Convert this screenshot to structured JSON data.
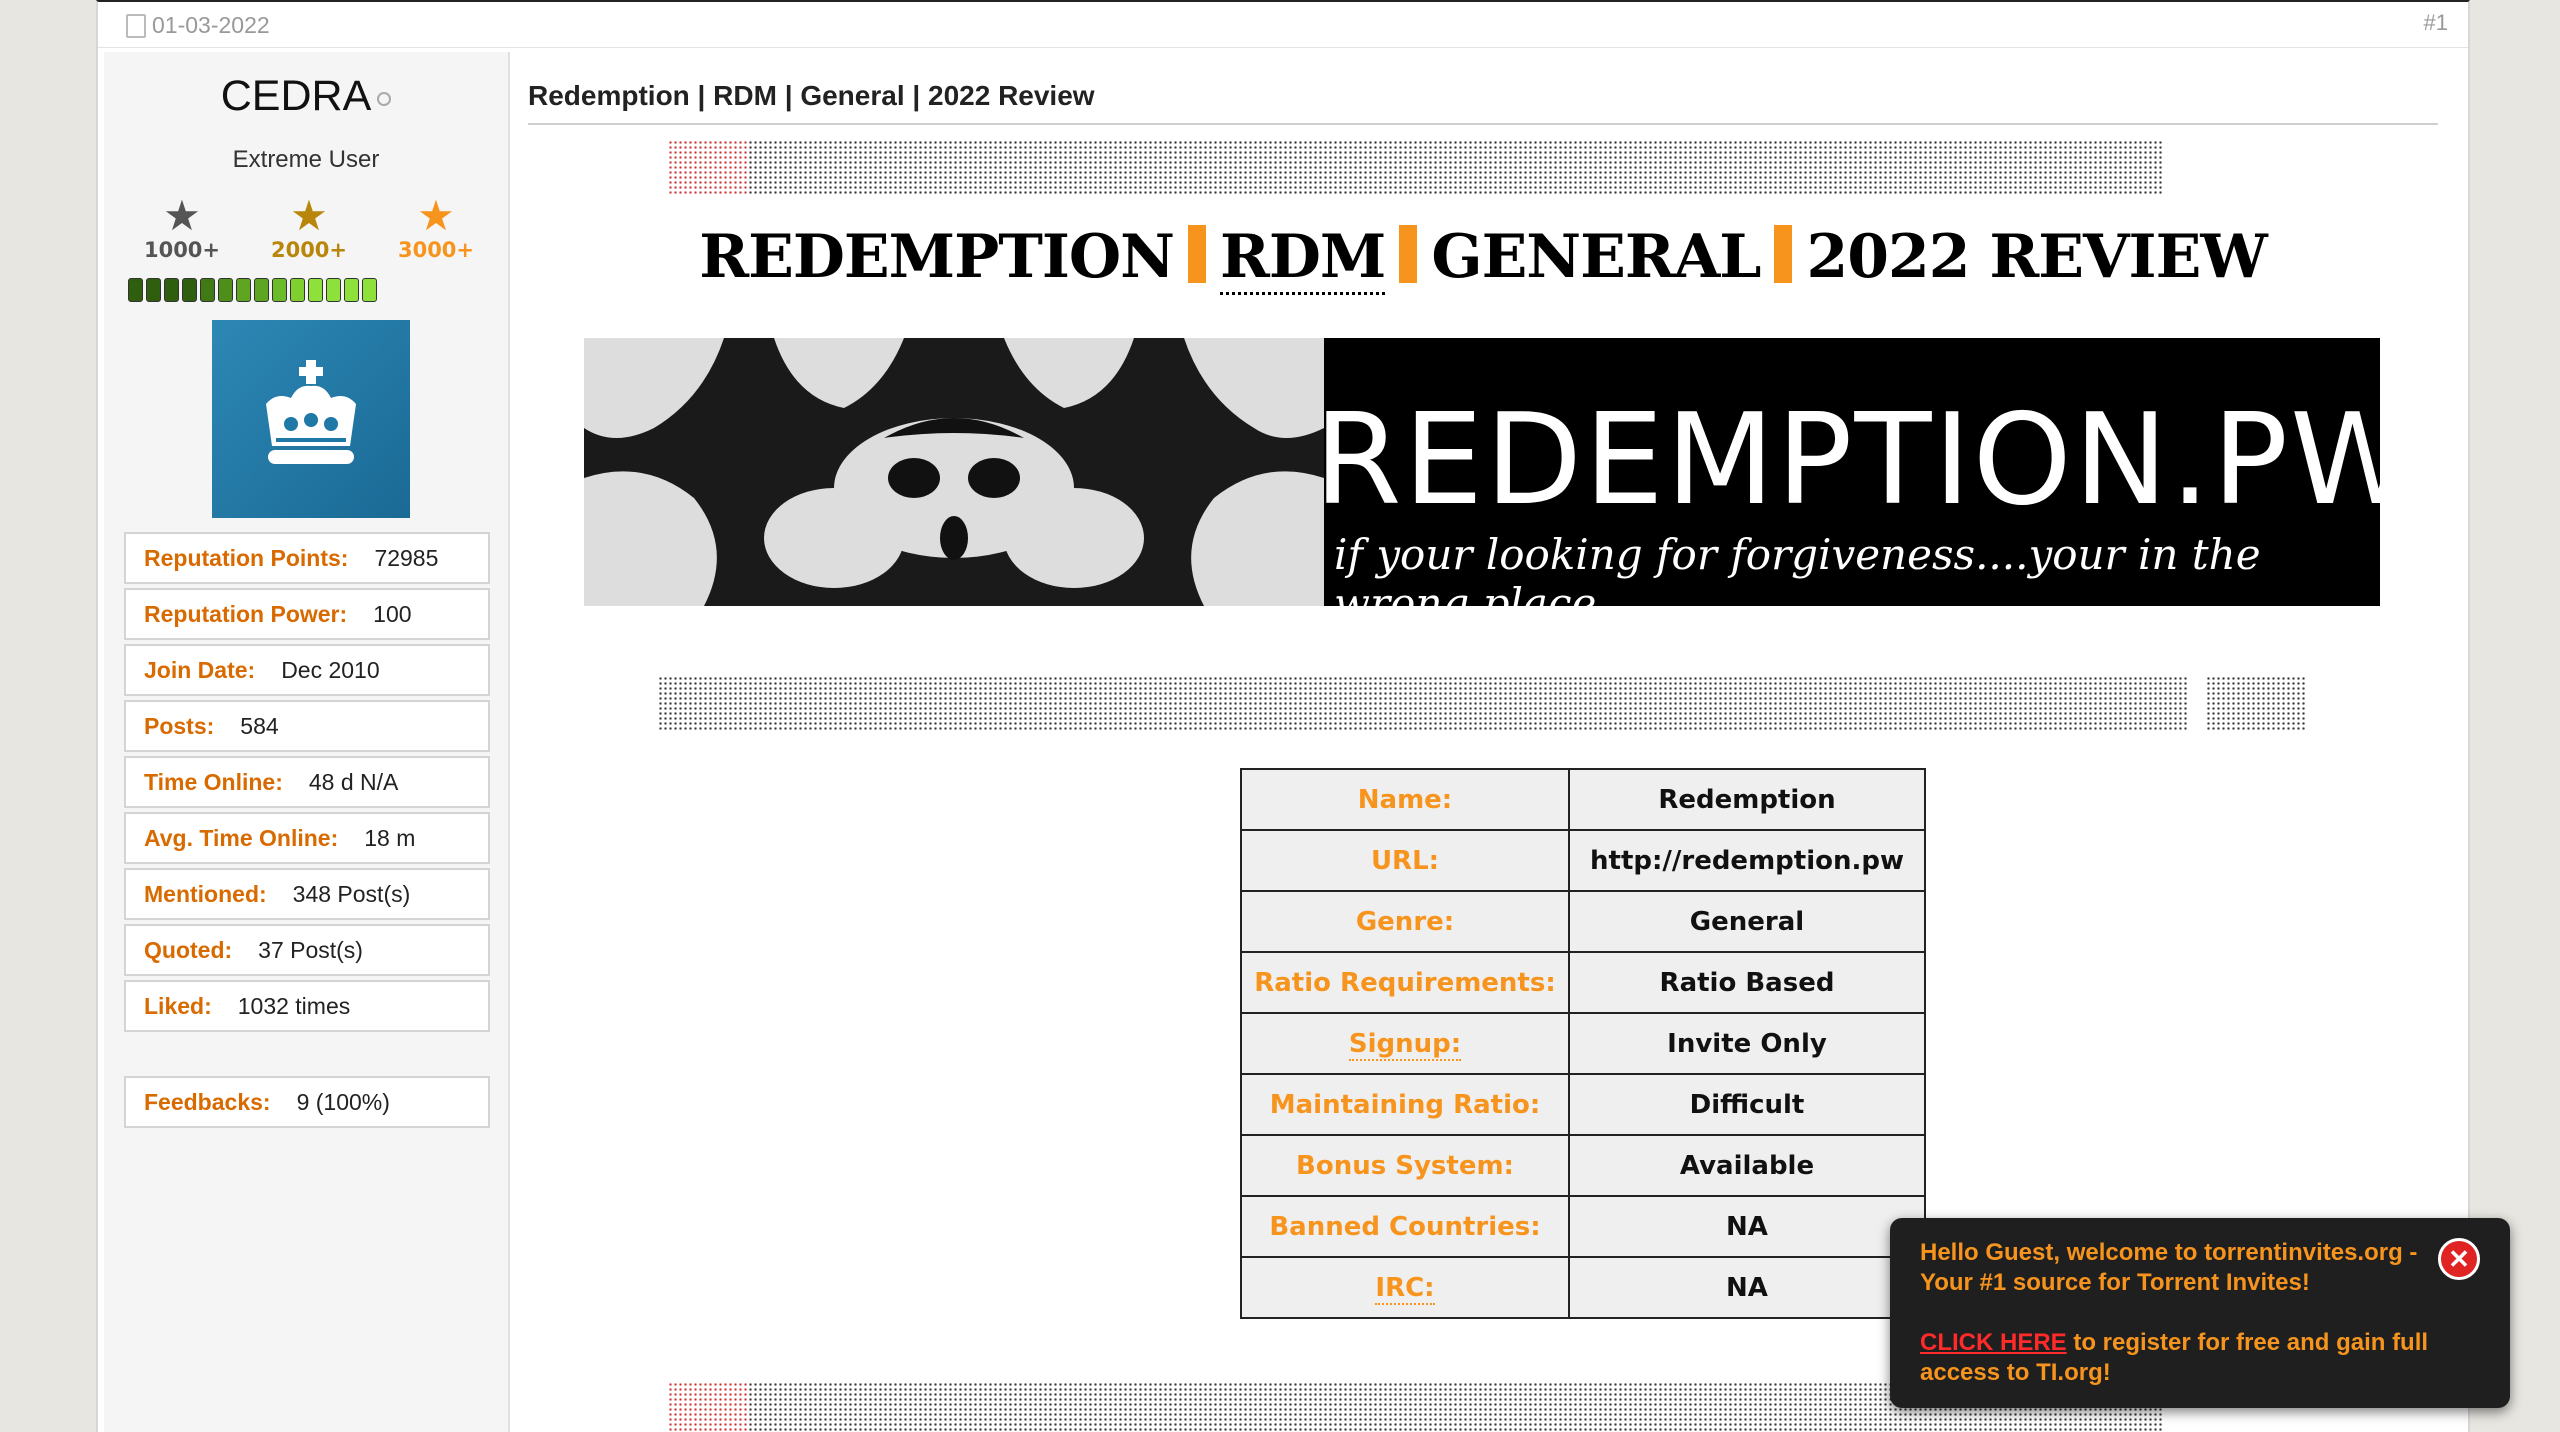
{
  "post": {
    "date": "01-03-2022",
    "number": "#1"
  },
  "user": {
    "name": "CEDRA",
    "title": "Extreme User",
    "awards": [
      {
        "label": "1000+",
        "color": "#555555"
      },
      {
        "label": "2000+",
        "color": "#b8860b"
      },
      {
        "label": "3000+",
        "color": "#f7941d"
      }
    ],
    "rep_segments": 14,
    "info": [
      {
        "label": "Reputation Points:",
        "value": "72985"
      },
      {
        "label": "Reputation Power:",
        "value": "100"
      },
      {
        "label": "Join Date:",
        "value": "Dec 2010"
      },
      {
        "label": "Posts:",
        "value": "584"
      },
      {
        "label": "Time Online:",
        "value": "48 d N/A"
      },
      {
        "label": "Avg. Time Online:",
        "value": "18 m"
      },
      {
        "label": "Mentioned:",
        "value": "348 Post(s)"
      },
      {
        "label": "Quoted:",
        "value": "37 Post(s)"
      },
      {
        "label": "Liked:",
        "value": "1032 times"
      }
    ],
    "feedback": {
      "label": "Feedbacks:",
      "value": "9 (100%)"
    }
  },
  "content": {
    "title": "Redemption | RDM | General | 2022 Review",
    "headline": [
      "REDEMPTION",
      "RDM",
      "GENERAL",
      "2022 REVIEW"
    ],
    "banner": {
      "title": "REDEMPTION.PW",
      "subtitle": "if your looking for forgiveness....your in the wrong place"
    },
    "table": [
      {
        "label": "Name:",
        "value": "Redemption"
      },
      {
        "label": "URL:",
        "value": "http://redemption.pw"
      },
      {
        "label": "Genre:",
        "value": "General"
      },
      {
        "label": "Ratio Requirements:",
        "value": "Ratio Based"
      },
      {
        "label": "Signup:",
        "value": "Invite Only"
      },
      {
        "label": "Maintaining Ratio:",
        "value": "Difficult"
      },
      {
        "label": "Bonus System:",
        "value": "Available"
      },
      {
        "label": "Banned Countries:",
        "value": "NA"
      },
      {
        "label": "IRC:",
        "value": "NA"
      }
    ]
  },
  "toast": {
    "line1": "Hello Guest, welcome to torrentinvites.org - Your #1 source for Torrent Invites!",
    "link": "CLICK HERE",
    "line2": " to register for free and gain full access to TI.org!"
  },
  "colors": {
    "accent": "#f7941d",
    "label": "#d86a00"
  }
}
